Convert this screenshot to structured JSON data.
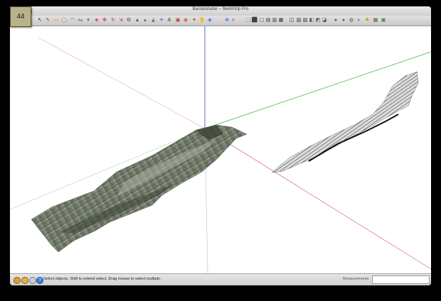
{
  "badge": {
    "number": "44"
  },
  "window": {
    "title": "Bacianstudar – SketchUp Pro"
  },
  "toolbar": {
    "tools": [
      {
        "name": "select-tool",
        "glyph": "↖",
        "color": "#222222"
      },
      {
        "name": "pencil-tool",
        "glyph": "✎",
        "color": "#c0392b"
      },
      {
        "name": "rectangle-tool",
        "glyph": "▭",
        "color": "#c97b18"
      },
      {
        "name": "circle-tool",
        "glyph": "◯",
        "color": "#c97b18"
      },
      {
        "name": "arc-tool",
        "glyph": "◠",
        "color": "#555555"
      },
      {
        "name": "freehand-tool",
        "glyph": "ᔓ",
        "color": "#555555"
      },
      {
        "name": "push-pull-tool",
        "glyph": "▾",
        "color": "#555555"
      },
      {
        "name": "eraser-tool",
        "glyph": "◆",
        "color": "#e05a7c"
      },
      {
        "name": "move-tool",
        "glyph": "✥",
        "color": "#c0392b"
      },
      {
        "name": "rotate-tool",
        "glyph": "↻",
        "color": "#c0392b"
      },
      {
        "name": "scale-tool",
        "glyph": "⇲",
        "color": "#c0392b"
      },
      {
        "name": "offset-tool",
        "glyph": "⧉",
        "color": "#555555"
      },
      {
        "name": "follow-me-tool",
        "glyph": "▲",
        "color": "#555555"
      },
      {
        "name": "tape-measure-tool",
        "glyph": "▴",
        "color": "#555555"
      },
      {
        "name": "protractor-tool",
        "glyph": "◭",
        "color": "#555555"
      },
      {
        "name": "axes-tool",
        "glyph": "✛",
        "color": "#1a6cd1"
      },
      {
        "name": "text-tool",
        "glyph": "A",
        "color": "#333333"
      },
      {
        "name": "paint-bucket-tool",
        "glyph": "▣",
        "color": "#c0392b"
      },
      {
        "name": "section-plane-tool",
        "glyph": "◉",
        "color": "#e05a1a"
      },
      {
        "name": "orbit-tool",
        "glyph": "✦",
        "color": "#c0392b"
      },
      {
        "name": "pan-tool",
        "glyph": "✋",
        "color": "#555555"
      },
      {
        "name": "zoom-window-tool",
        "glyph": "◈",
        "color": "#1a6cd1"
      },
      {
        "name": "zoom-extents-tool",
        "glyph": "⊕",
        "color": "#1a6cd1"
      },
      {
        "name": "zoom-tool",
        "glyph": "⌕",
        "color": "#333333"
      },
      {
        "name": "iso-view",
        "glyph": "⬚",
        "color": "#333333"
      },
      {
        "name": "top-view",
        "glyph": "⬛",
        "color": "#333333"
      },
      {
        "name": "front-view",
        "glyph": "▢",
        "color": "#333333"
      },
      {
        "name": "right-view",
        "glyph": "▤",
        "color": "#333333"
      },
      {
        "name": "back-view",
        "glyph": "▥",
        "color": "#333333"
      },
      {
        "name": "left-view",
        "glyph": "▦",
        "color": "#333333"
      },
      {
        "name": "xray-style",
        "glyph": "◫",
        "color": "#333333"
      },
      {
        "name": "wireframe-style",
        "glyph": "▨",
        "color": "#333333"
      },
      {
        "name": "hidden-line-style",
        "glyph": "▧",
        "color": "#333333"
      },
      {
        "name": "shaded-style",
        "glyph": "◧",
        "color": "#555555"
      },
      {
        "name": "textured-style",
        "glyph": "◩",
        "color": "#555555"
      },
      {
        "name": "monochrome-style",
        "glyph": "◪",
        "color": "#555555"
      },
      {
        "name": "get-models",
        "glyph": "●",
        "color": "#1a6cd1"
      },
      {
        "name": "share-model",
        "glyph": "●",
        "color": "#2e8b2e"
      },
      {
        "name": "add-location",
        "glyph": "◍",
        "color": "#555555"
      },
      {
        "name": "terrain-toggle",
        "glyph": "◐",
        "color": "#555555"
      },
      {
        "name": "photo-texture",
        "glyph": "✚",
        "color": "#c79a18"
      },
      {
        "name": "layers-tool",
        "glyph": "▦",
        "color": "#555555"
      },
      {
        "name": "components-tool",
        "glyph": "▣",
        "color": "#2e8b2e"
      }
    ]
  },
  "status": {
    "message": "Select objects. Shift to extend select. Drag mouse to select multiple.",
    "measurements_label": "Measurements",
    "measurements_value": ""
  },
  "colors": {
    "axis_red": "#e08a9a",
    "axis_green": "#3aaf3a",
    "axis_blue": "#4040c0",
    "badge_bg": "#b7b28a"
  }
}
